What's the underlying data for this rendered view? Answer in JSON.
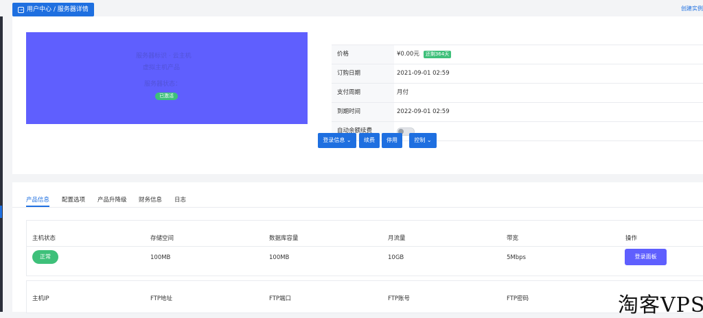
{
  "header": {
    "breadcrumb": "用户中心 / 服务器详情",
    "create_link": "创建实例"
  },
  "banner": {
    "line1": "服务器标识 · 云主机",
    "line2": "虚拟主机产品",
    "line3": "服务器状态：",
    "badge": "已激活"
  },
  "info": {
    "rows": [
      {
        "label": "价格",
        "value": "¥0.00元",
        "badge": "还剩364天"
      },
      {
        "label": "订购日期",
        "value": "2021-09-01 02:59"
      },
      {
        "label": "支付周期",
        "value": "月付"
      },
      {
        "label": "到期时间",
        "value": "2022-09-01 02:59"
      },
      {
        "label": "自动余额续费",
        "value": ""
      }
    ]
  },
  "actions": {
    "login": "登录信息",
    "renew": "续费",
    "stop": "停用",
    "control": "控制"
  },
  "tabs": [
    "产品信息",
    "配置选项",
    "产品升降级",
    "财务信息",
    "日志"
  ],
  "table1": {
    "headers": [
      "主机状态",
      "存储空间",
      "数据库容量",
      "月流量",
      "带宽",
      "操作"
    ],
    "status": "正常",
    "values": [
      "100MB",
      "100MB",
      "10GB",
      "5Mbps"
    ],
    "action_label": "登录面板"
  },
  "table2": {
    "headers": [
      "主机IP",
      "FTP地址",
      "FTP端口",
      "FTP账号",
      "FTP密码"
    ]
  },
  "watermark": "淘客VPS"
}
